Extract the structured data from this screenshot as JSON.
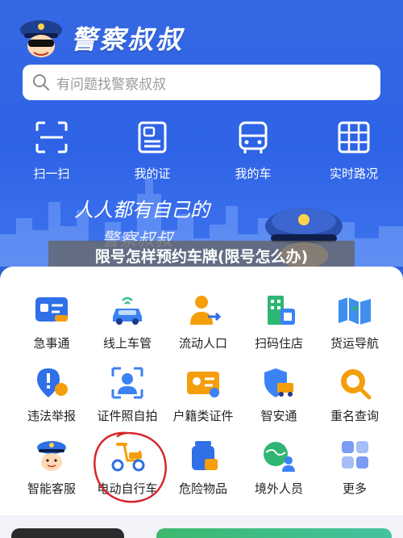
{
  "app": {
    "title": "警察叔叔"
  },
  "search": {
    "placeholder": "有问题找警察叔叔"
  },
  "quick_actions": [
    {
      "label": "扫一扫",
      "icon": "scan-icon"
    },
    {
      "label": "我的证",
      "icon": "id-card-icon"
    },
    {
      "label": "我的车",
      "icon": "car-front-icon"
    },
    {
      "label": "实时路况",
      "icon": "traffic-map-icon"
    }
  ],
  "banner": {
    "slogan_line1": "人人都有自己的",
    "slogan_line2": "警察叔叔"
  },
  "overlay": {
    "text": "限号怎样预约车牌(限号怎么办)"
  },
  "services": [
    {
      "label": "急事通",
      "icon": "urgent-card-icon",
      "color": "#2f6fe8"
    },
    {
      "label": "线上车管",
      "icon": "car-wifi-icon",
      "color": "#3b82f6"
    },
    {
      "label": "流动人口",
      "icon": "person-arrow-icon",
      "color": "#f59e0b"
    },
    {
      "label": "扫码住店",
      "icon": "hotel-icon",
      "color": "#2fb574"
    },
    {
      "label": "货运导航",
      "icon": "map-icon",
      "color": "#3f8ef0"
    },
    {
      "label": "违法举报",
      "icon": "report-pin-icon",
      "color": "#2f6fe8"
    },
    {
      "label": "证件照自拍",
      "icon": "id-photo-icon",
      "color": "#3b82f6"
    },
    {
      "label": "户籍类证件",
      "icon": "household-card-icon",
      "color": "#f59e0b"
    },
    {
      "label": "智安通",
      "icon": "shield-truck-icon",
      "color": "#3b82f6"
    },
    {
      "label": "重名查询",
      "icon": "name-search-icon",
      "color": "#f59e0b"
    },
    {
      "label": "智能客服",
      "icon": "police-avatar-icon",
      "color": "#2f6fe8"
    },
    {
      "label": "电动自行车",
      "icon": "e-bike-icon",
      "color": "#f59e0b"
    },
    {
      "label": "危险物品",
      "icon": "hazard-bottle-icon",
      "color": "#2f6fe8"
    },
    {
      "label": "境外人员",
      "icon": "globe-person-icon",
      "color": "#2fb574"
    },
    {
      "label": "更多",
      "icon": "more-grid-icon",
      "color": "#7b9cf5"
    }
  ]
}
